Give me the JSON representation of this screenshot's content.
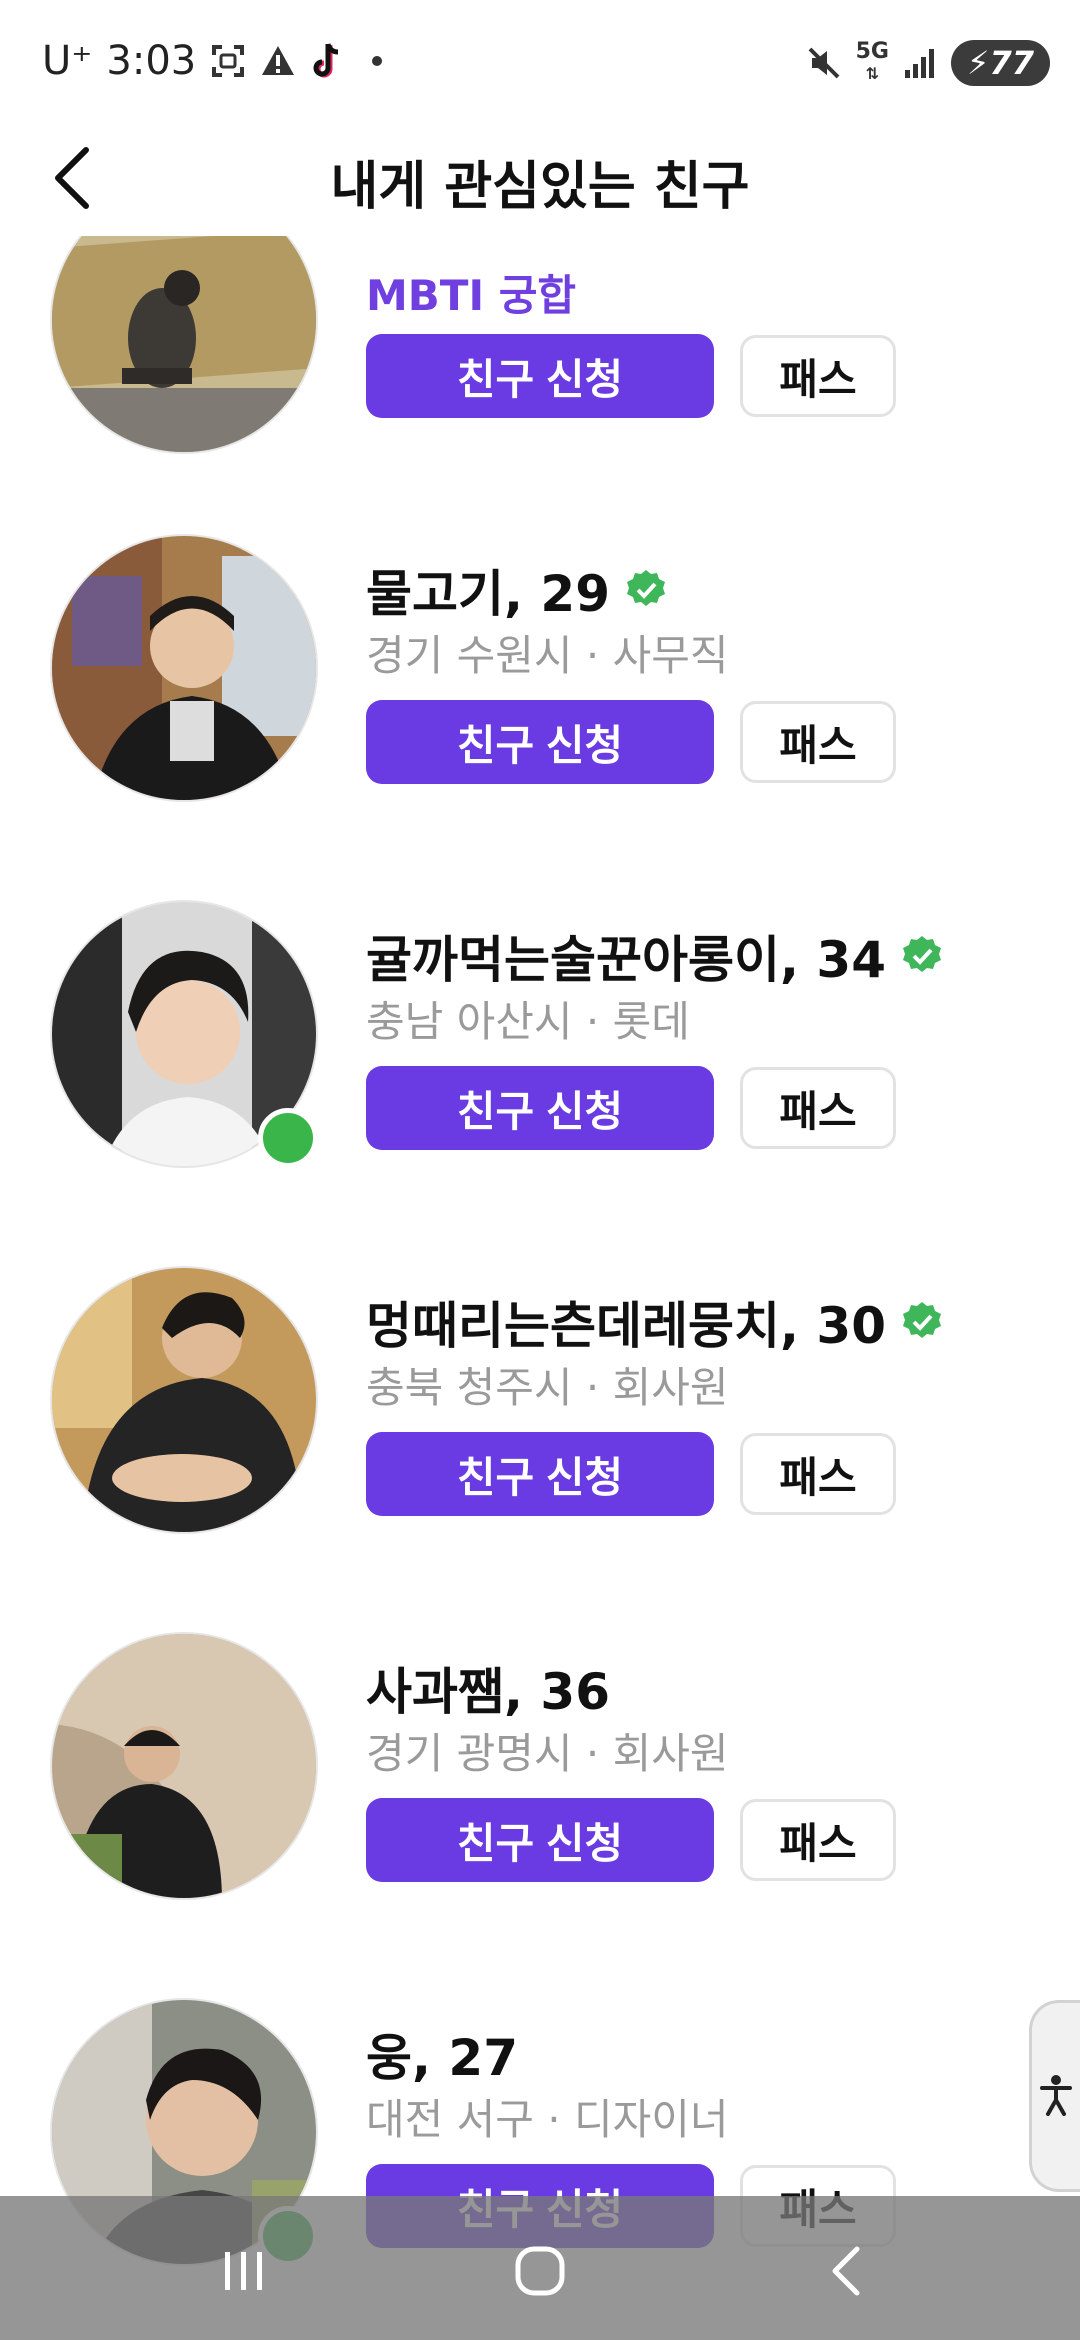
{
  "status_bar": {
    "carrier": "U⁺",
    "time": "3:03",
    "network": "5G",
    "battery": "77",
    "icons": [
      "screenshot-icon",
      "warning-icon",
      "tiktok-icon",
      "dot-icon",
      "mute-icon",
      "signal-icon",
      "battery-icon"
    ]
  },
  "header": {
    "title": "내게 관심있는 친구",
    "back_icon": "chevron-left-icon"
  },
  "buttons": {
    "friend_request": "친구 신청",
    "pass": "패스"
  },
  "colors": {
    "accent": "#6a3be3",
    "mbti_text": "#6f3fe0",
    "verified": "#3fb65a",
    "online": "#39b54a"
  },
  "items": [
    {
      "name": "",
      "detail": "MBTI 궁합",
      "verified": false,
      "online": false
    },
    {
      "name": "물고기, 29",
      "detail": "경기 수원시 · 사무직",
      "verified": true,
      "online": false
    },
    {
      "name": "귤까먹는술꾼아롱이, 34",
      "detail": "충남 아산시 · 롯데",
      "verified": true,
      "online": true
    },
    {
      "name": "멍때리는츤데레뭉치, 30",
      "detail": "충북 청주시 · 회사원",
      "verified": true,
      "online": false
    },
    {
      "name": "사과쨈, 36",
      "detail": "경기 광명시 · 회사원",
      "verified": false,
      "online": false
    },
    {
      "name": "웅, 27",
      "detail": "대전 서구 · 디자이너",
      "verified": false,
      "online": true
    }
  ],
  "nav": {
    "icons": [
      "recents-icon",
      "home-icon",
      "back-icon"
    ]
  },
  "accessibility_icon": "accessibility-icon"
}
